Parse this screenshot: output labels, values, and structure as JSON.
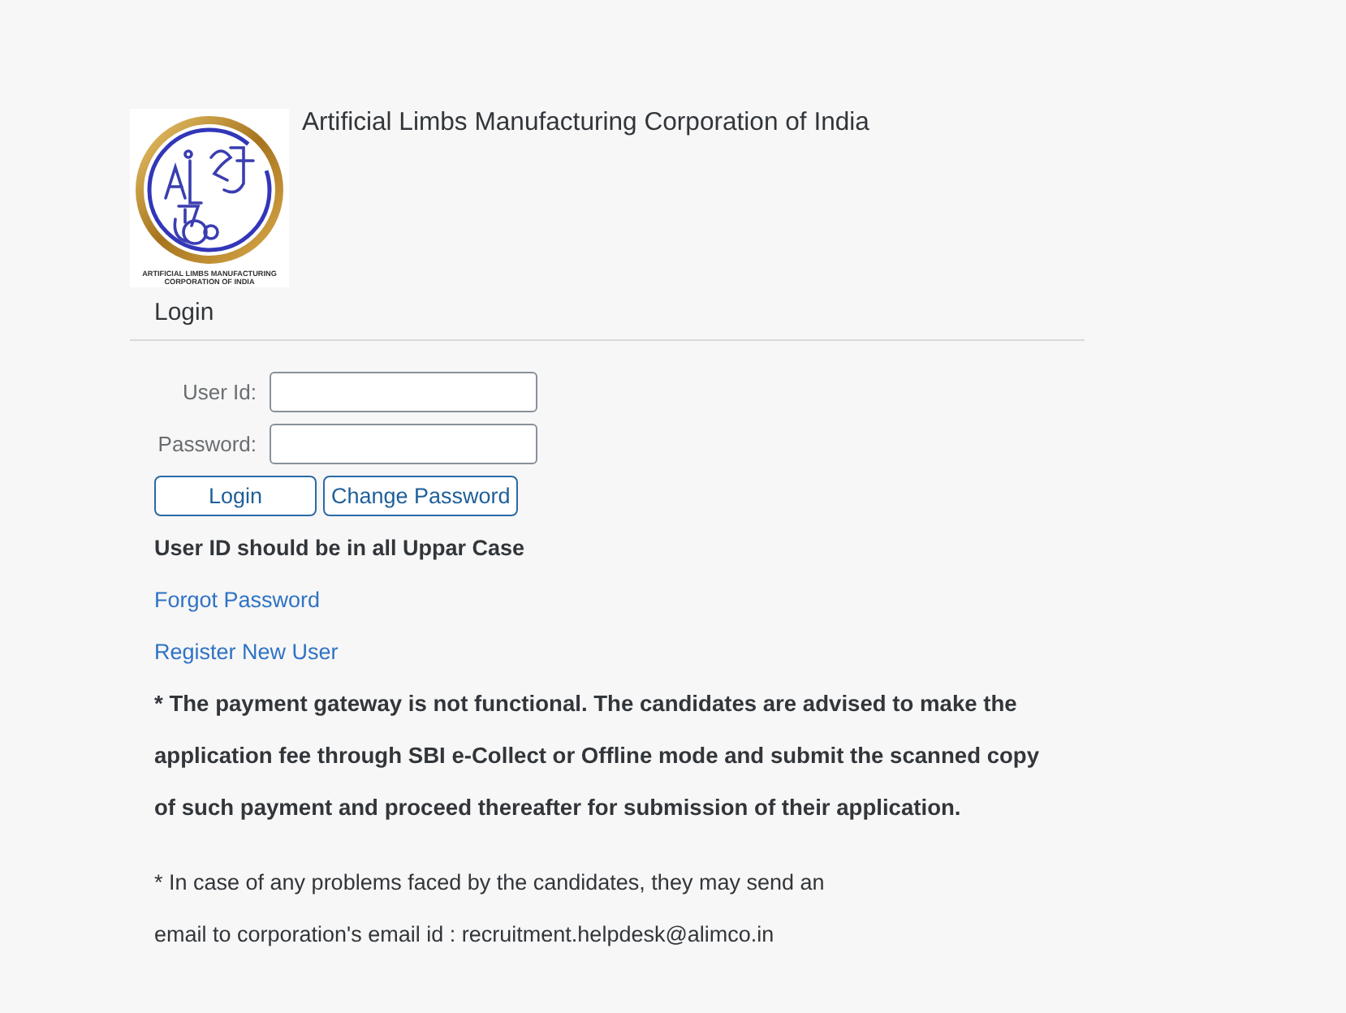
{
  "header": {
    "organization": "Artificial Limbs Manufacturing Corporation of India",
    "logo_caption": "ARTIFICIAL LIMBS MANUFACTURING CORPORATION OF INDIA"
  },
  "section_title": "Login",
  "form": {
    "fields": [
      {
        "label": "User Id:"
      },
      {
        "label": "Password:"
      }
    ],
    "buttons": [
      "Login",
      "Change Password"
    ]
  },
  "case_notice": "User ID should be in all Uppar Case",
  "links": [
    "Forgot Password",
    "Register New User"
  ],
  "payment_notice": "* The payment gateway is not functional. The candidates are advised to make the application fee through SBI e-Collect or Offline mode and submit the scanned copy of such payment and proceed thereafter for submission of their application.",
  "contact_note": "* In case of any problems faced by the candidates, they may send an email to corporation's email id : recruitment.helpdesk@alimco.in"
}
